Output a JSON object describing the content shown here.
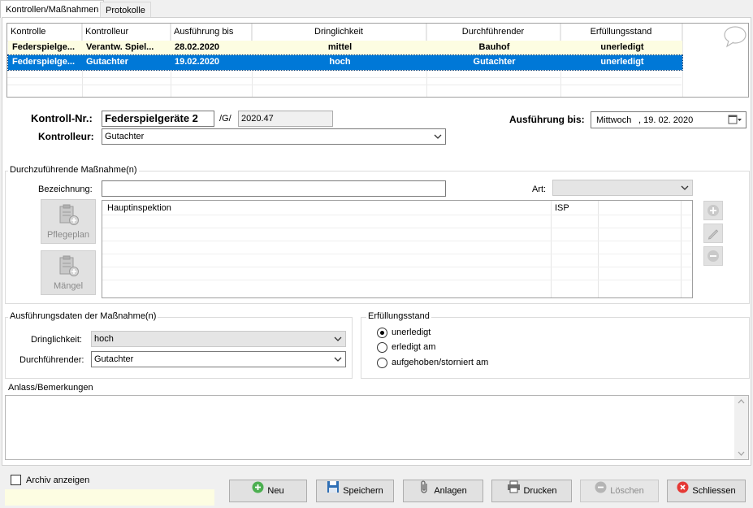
{
  "tabs": [
    {
      "label": "Kontrollen/Maßnahmen",
      "active": true
    },
    {
      "label": "Protokolle",
      "active": false
    }
  ],
  "grid": {
    "columns": [
      "Kontrolle",
      "Kontrolleur",
      "Ausführung bis",
      "Dringlichkeit",
      "Durchführender",
      "Erfüllungsstand"
    ],
    "rows": [
      {
        "kontrolle": "Federspielge...",
        "kontrolleur": "Verantw. Spiel...",
        "ausfuehrung": "28.02.2020",
        "dringlichkeit": "mittel",
        "durchfuehrender": "Bauhof",
        "erfuellung": "unerledigt"
      },
      {
        "kontrolle": "Federspielge...",
        "kontrolleur": "Gutachter",
        "ausfuehrung": "19.02.2020",
        "dringlichkeit": "hoch",
        "durchfuehrender": "Gutachter",
        "erfuellung": "unerledigt"
      }
    ],
    "selected_row": 1
  },
  "form": {
    "kontroll_nr_label": "Kontroll-Nr.:",
    "kontroll_nr_value": "Federspielgeräte 2",
    "g_label": "/G/",
    "g_value": "2020.47",
    "ausfuehrung_bis_label": "Ausführung bis:",
    "ausfuehrung_bis_day": "Mittwoch",
    "ausfuehrung_bis_date": ", 19. 02. 2020",
    "kontrolleur_label": "Kontrolleur:",
    "kontrolleur_value": "Gutachter"
  },
  "massnahme": {
    "group_title": "Durchzuführende Maßnahme(n)",
    "bezeichnung_label": "Bezeichnung:",
    "bezeichnung_value": "",
    "art_label": "Art:",
    "art_value": "",
    "pflegeplan_label": "Pflegeplan",
    "maengel_label": "Mängel",
    "list": [
      {
        "name": "Hauptinspektion",
        "art": "ISP"
      }
    ]
  },
  "ausfuehrung": {
    "group_title": "Ausführungsdaten der Maßnahme(n)",
    "dringlichkeit_label": "Dringlichkeit:",
    "dringlichkeit_value": "hoch",
    "durchfuehrender_label": "Durchführender:",
    "durchfuehrender_value": "Gutachter"
  },
  "erfuellung": {
    "group_title": "Erfüllungsstand",
    "options": [
      "unerledigt",
      "erledigt am",
      "aufgehoben/storniert am"
    ],
    "selected": 0
  },
  "anlass": {
    "label": "Anlass/Bemerkungen",
    "value": ""
  },
  "footer": {
    "archiv_label": "Archiv anzeigen",
    "archiv_checked": false,
    "buttons": {
      "neu": "Neu",
      "speichern": "Speichern",
      "anlagen": "Anlagen",
      "drucken": "Drucken",
      "loeschen": "Löschen",
      "schliessen": "Schliessen"
    }
  },
  "colors": {
    "selection": "#0078d7",
    "row_highlight": "#fdfde2",
    "neu_icon": "#4caf50",
    "schliessen_icon": "#e53935"
  }
}
